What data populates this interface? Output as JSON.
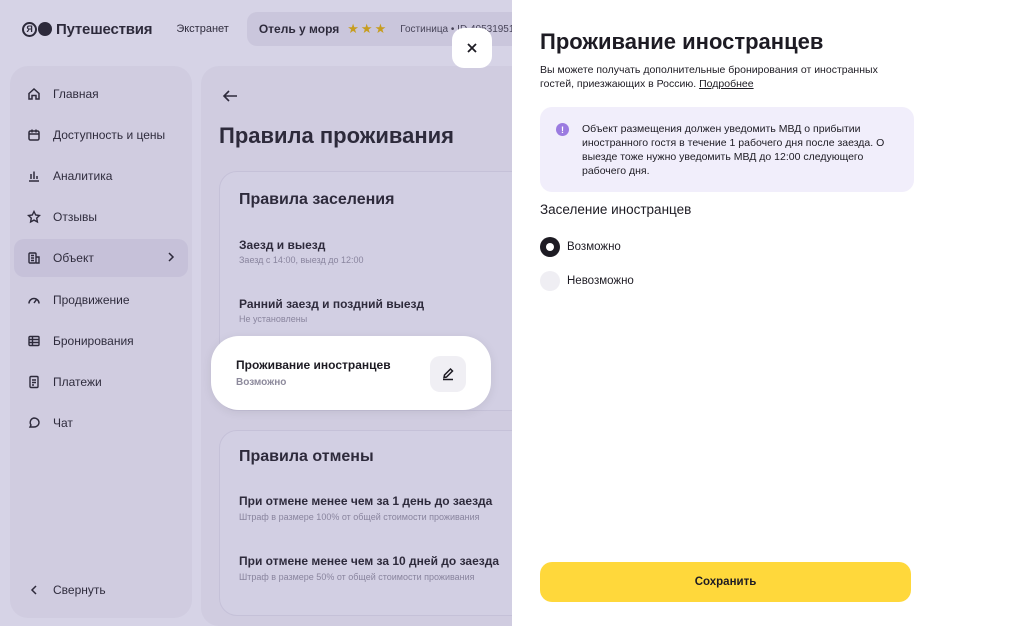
{
  "header": {
    "logo_text": "Путешествия",
    "logo_mark": "Я",
    "section": "Экстранет",
    "hotel_name": "Отель у моря",
    "hotel_stars": 3,
    "hotel_type": "Гостиница • ID 40531951"
  },
  "sidebar": {
    "items": [
      {
        "label": "Главная",
        "icon": "home-icon"
      },
      {
        "label": "Доступность и цены",
        "icon": "calendar-icon"
      },
      {
        "label": "Аналитика",
        "icon": "chart-icon"
      },
      {
        "label": "Отзывы",
        "icon": "star-icon"
      },
      {
        "label": "Объект",
        "icon": "building-icon",
        "active": true
      },
      {
        "label": "Продвижение",
        "icon": "speedometer-icon"
      },
      {
        "label": "Бронирования",
        "icon": "table-icon"
      },
      {
        "label": "Платежи",
        "icon": "document-icon"
      },
      {
        "label": "Чат",
        "icon": "chat-icon"
      }
    ],
    "collapse_label": "Свернуть"
  },
  "content": {
    "title": "Правила проживания",
    "checkin_card": {
      "title": "Правила заселения",
      "rules": [
        {
          "title": "Заезд и выезд",
          "subtitle": "Заезд с 14:00, выезд до 12:00"
        },
        {
          "title": "Ранний заезд и поздний выезд",
          "subtitle": "Не установлены"
        }
      ]
    },
    "highlight": {
      "title": "Проживание иностранцев",
      "subtitle": "Возможно"
    },
    "cancel_card": {
      "title": "Правила отмены",
      "rules": [
        {
          "title": "При отмене менее чем за 1 день до заезда",
          "subtitle": "Штраф в размере 100% от общей стоимости проживания"
        },
        {
          "title": "При отмене менее чем за 10 дней до заезда",
          "subtitle": "Штраф в размере 50% от общей стоимости проживания"
        }
      ]
    }
  },
  "panel": {
    "title": "Проживание иностранцев",
    "description": "Вы можете получать дополнительные бронирования от иностранных гостей, приезжающих в Россию.",
    "link": "Подробнее",
    "notice_icon": "!",
    "notice": "Объект размещения должен уведомить МВД о прибытии иностранного гостя в течение 1 рабочего дня после заезда. О выезде тоже нужно уведомить МВД до 12:00 следующего рабочего дня.",
    "section_title": "Заселение иностранцев",
    "options": [
      {
        "label": "Возможно",
        "checked": true
      },
      {
        "label": "Невозможно",
        "checked": false
      }
    ],
    "save_label": "Сохранить"
  },
  "colors": {
    "accent": "#ffd83b",
    "notice_bg": "#f1eefb",
    "notice_icon": "#9b7be0"
  }
}
